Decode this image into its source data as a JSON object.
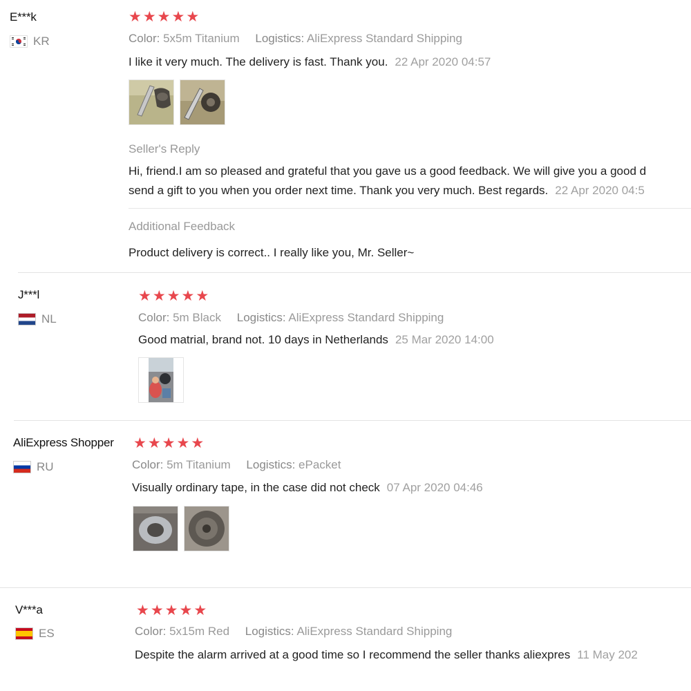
{
  "reviews": [
    {
      "user": "E***k",
      "country": "KR",
      "rating": 5,
      "color_label": "Color:",
      "color_value": "5x5m Titanium",
      "logistics_label": "Logistics:",
      "logistics_value": "AliExpress Standard Shipping",
      "text": "I like it very much. The delivery is fast. Thank you.",
      "date": "22 Apr 2020 04:57",
      "seller_reply_title": "Seller's Reply",
      "seller_reply_line1": "Hi, friend.I am so pleased and grateful that you gave us a good feedback. We will give you a good d",
      "seller_reply_line2": "send a gift to you when you order next time. Thank you very much. Best regards.",
      "seller_reply_date": "22 Apr 2020 04:5",
      "additional_title": "Additional Feedback",
      "additional_text": "Product delivery is correct.. I really like you, Mr. Seller~"
    },
    {
      "user": "J***l",
      "country": "NL",
      "rating": 5,
      "color_label": "Color:",
      "color_value": "5m Black",
      "logistics_label": "Logistics:",
      "logistics_value": "AliExpress Standard Shipping",
      "text": "Good matrial, brand not. 10 days in Netherlands",
      "date": "25 Mar 2020 14:00"
    },
    {
      "user": "AliExpress Shopper",
      "country": "RU",
      "rating": 5,
      "color_label": "Color:",
      "color_value": "5m Titanium",
      "logistics_label": "Logistics:",
      "logistics_value": "ePacket",
      "text": "Visually ordinary tape, in the case did not check",
      "date": "07 Apr 2020 04:46"
    },
    {
      "user": "V***a",
      "country": "ES",
      "rating": 5,
      "color_label": "Color:",
      "color_value": "5x15m Red",
      "logistics_label": "Logistics:",
      "logistics_value": "AliExpress Standard Shipping",
      "text": "Despite the alarm arrived at a good time so I recommend the seller thanks aliexpres",
      "date": "11 May 202"
    }
  ],
  "colors": {
    "star": "#e8474d",
    "muted": "#9a9a9a",
    "text": "#222222"
  }
}
